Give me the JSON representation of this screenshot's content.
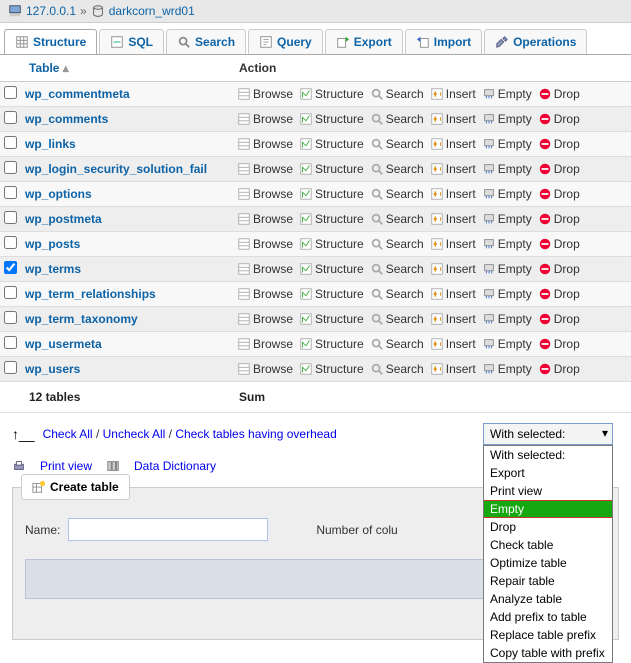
{
  "breadcrumb": {
    "host": "127.0.0.1",
    "db": "darkcorn_wrd01"
  },
  "tabs": [
    {
      "label": "Structure",
      "icon": "structure",
      "active": true
    },
    {
      "label": "SQL",
      "icon": "sql"
    },
    {
      "label": "Search",
      "icon": "search"
    },
    {
      "label": "Query",
      "icon": "query"
    },
    {
      "label": "Export",
      "icon": "export"
    },
    {
      "label": "Import",
      "icon": "import"
    },
    {
      "label": "Operations",
      "icon": "operations"
    }
  ],
  "table_header": {
    "col_table": "Table",
    "col_action": "Action"
  },
  "actions": {
    "browse": "Browse",
    "structure": "Structure",
    "search": "Search",
    "insert": "Insert",
    "empty": "Empty",
    "drop": "Drop"
  },
  "tables": [
    {
      "name": "wp_commentmeta",
      "checked": false
    },
    {
      "name": "wp_comments",
      "checked": false
    },
    {
      "name": "wp_links",
      "checked": false
    },
    {
      "name": "wp_login_security_solution_fail",
      "checked": false
    },
    {
      "name": "wp_options",
      "checked": false
    },
    {
      "name": "wp_postmeta",
      "checked": false
    },
    {
      "name": "wp_posts",
      "checked": false
    },
    {
      "name": "wp_terms",
      "checked": true
    },
    {
      "name": "wp_term_relationships",
      "checked": false
    },
    {
      "name": "wp_term_taxonomy",
      "checked": false
    },
    {
      "name": "wp_usermeta",
      "checked": false
    },
    {
      "name": "wp_users",
      "checked": false
    }
  ],
  "summary": {
    "count": "12 tables",
    "label": "Sum"
  },
  "checkrow": {
    "check_all": "Check All",
    "uncheck_all": "Uncheck All",
    "overhead": "Check tables having overhead"
  },
  "select": {
    "selected": "With selected:",
    "options": [
      "With selected:",
      "Export",
      "Print view",
      "Empty",
      "Drop",
      "Check table",
      "Optimize table",
      "Repair table",
      "Analyze table",
      "Add prefix to table",
      "Replace table prefix",
      "Copy table with prefix"
    ],
    "highlight_index": 3
  },
  "util": {
    "print_view": "Print view",
    "data_dictionary": "Data Dictionary"
  },
  "create": {
    "legend": "Create table",
    "name_label": "Name:",
    "name_value": "",
    "cols_label": "Number of colu"
  }
}
